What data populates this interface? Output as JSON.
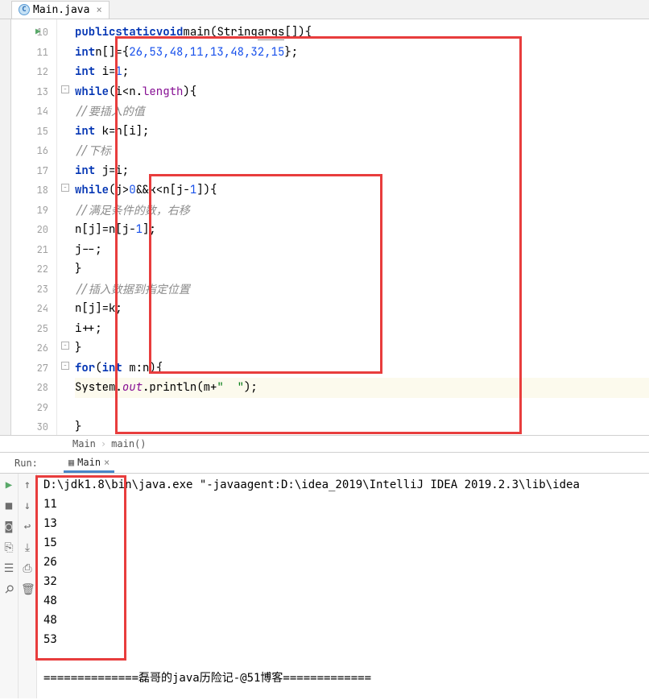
{
  "tab": {
    "filename": "Main.java",
    "icon_label": "C"
  },
  "gutter": {
    "start": 10,
    "end": 30
  },
  "code": {
    "l10": {
      "kw1": "public",
      "kw2": "static",
      "kw3": "void",
      "fn": "main",
      "param": "String",
      "argname": "args",
      "tail": "[]){"
    },
    "l11": {
      "kw": "int",
      "var": "n[]={",
      "nums": "26,53,48,11,13,48,32,15",
      "tail": "};"
    },
    "l12": {
      "kw": "int",
      "body": " i=",
      "num": "1",
      "tail": ";"
    },
    "l13": {
      "kw": "while",
      "body": "(i<n.",
      "prop": "length",
      "tail": "){"
    },
    "l14": {
      "comment": "//要插入的值"
    },
    "l15": {
      "kw": "int",
      "body": " k=n[i];"
    },
    "l16": {
      "comment": "//下标"
    },
    "l17": {
      "kw": "int",
      "body": " j=i;"
    },
    "l18": {
      "kw": "while",
      "body": "(j>",
      "n0": "0",
      "mid": "&&k<n[j-",
      "n1": "1",
      "tail": "]){"
    },
    "l19": {
      "comment": "//满足条件的数，右移"
    },
    "l20": {
      "body": "n[j]=n[j-",
      "num": "1",
      "tail": "];"
    },
    "l21": {
      "body": "j--;"
    },
    "l22": {
      "body": "}"
    },
    "l23": {
      "comment": "//插入数据到指定位置"
    },
    "l24": {
      "body": "n[j]=k;"
    },
    "l25": {
      "body": "i++;"
    },
    "l26": {
      "body": "}"
    },
    "l27": {
      "kw": "for",
      "paren": "(",
      "kw2": "int",
      "body": " m:n){"
    },
    "l28": {
      "cls": "System.",
      "field": "out",
      "dot": ".println(m+",
      "str": "\"  \"",
      "tail": ");"
    },
    "l29": {
      "body": ""
    },
    "l30": {
      "body": "}"
    }
  },
  "breadcrumb": {
    "a": "Main",
    "b": "main()"
  },
  "run": {
    "label": "Run:",
    "tab_name": "Main"
  },
  "output": {
    "cmd": "D:\\jdk1.8\\bin\\java.exe \"-javaagent:D:\\idea_2019\\IntelliJ IDEA 2019.2.3\\lib\\idea",
    "lines": [
      "11",
      "13",
      "15",
      "26",
      "32",
      "48",
      "48",
      "53"
    ],
    "footer": "==============磊哥的java历险记-@51博客============="
  }
}
